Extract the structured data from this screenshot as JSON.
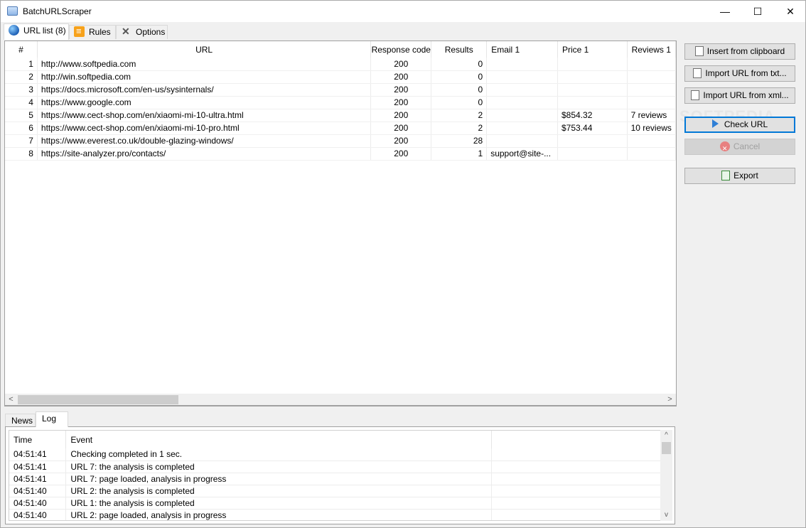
{
  "window": {
    "title": "BatchURLScraper",
    "minimize_glyph": "—",
    "maximize_glyph": "☐",
    "close_glyph": "✕"
  },
  "tabs": [
    {
      "label": "URL list (8)",
      "icon": "globe-icon"
    },
    {
      "label": "Rules",
      "icon": "rules-list-icon"
    },
    {
      "label": "Options",
      "icon": "tools-icon"
    }
  ],
  "grid": {
    "columns": [
      "#",
      "URL",
      "Response code",
      "Results",
      "Email 1",
      "Price 1",
      "Reviews 1"
    ],
    "rows": [
      {
        "n": "1",
        "url": "http://www.softpedia.com",
        "code": "200",
        "results": "0",
        "email": "",
        "price": "",
        "reviews": ""
      },
      {
        "n": "2",
        "url": "http://win.softpedia.com",
        "code": "200",
        "results": "0",
        "email": "",
        "price": "",
        "reviews": ""
      },
      {
        "n": "3",
        "url": "https://docs.microsoft.com/en-us/sysinternals/",
        "code": "200",
        "results": "0",
        "email": "",
        "price": "",
        "reviews": ""
      },
      {
        "n": "4",
        "url": "https://www.google.com",
        "code": "200",
        "results": "0",
        "email": "",
        "price": "",
        "reviews": ""
      },
      {
        "n": "5",
        "url": "https://www.cect-shop.com/en/xiaomi-mi-10-ultra.html",
        "code": "200",
        "results": "2",
        "email": "",
        "price": "$854.32",
        "reviews": "7 reviews"
      },
      {
        "n": "6",
        "url": "https://www.cect-shop.com/en/xiaomi-mi-10-pro.html",
        "code": "200",
        "results": "2",
        "email": "",
        "price": "$753.44",
        "reviews": "10 reviews"
      },
      {
        "n": "7",
        "url": "https://www.everest.co.uk/double-glazing-windows/",
        "code": "200",
        "results": "28",
        "email": "",
        "price": "",
        "reviews": ""
      },
      {
        "n": "8",
        "url": "https://site-analyzer.pro/contacts/",
        "code": "200",
        "results": "1",
        "email": "support@site-...",
        "price": "",
        "reviews": ""
      }
    ]
  },
  "scroll": {
    "left": "<",
    "right": ">",
    "up": "^",
    "down": "v"
  },
  "side_buttons": {
    "insert": "Insert from clipboard",
    "import_txt": "Import URL from txt...",
    "import_xml": "Import URL from xml...",
    "check": "Check URL",
    "cancel": "Cancel",
    "export": "Export"
  },
  "watermark": "SOFTPEDIA",
  "log_tabs": [
    "News",
    "Log"
  ],
  "log": {
    "columns": [
      "Time",
      "Event"
    ],
    "rows": [
      {
        "time": "04:51:41",
        "event": "Checking completed in 1 sec."
      },
      {
        "time": "04:51:41",
        "event": "URL 7: the analysis is completed"
      },
      {
        "time": "04:51:41",
        "event": "URL 7: page loaded, analysis in progress"
      },
      {
        "time": "04:51:40",
        "event": "URL 2: the analysis is completed"
      },
      {
        "time": "04:51:40",
        "event": "URL 1: the analysis is completed"
      },
      {
        "time": "04:51:40",
        "event": "URL 2: page loaded, analysis in progress"
      }
    ]
  }
}
